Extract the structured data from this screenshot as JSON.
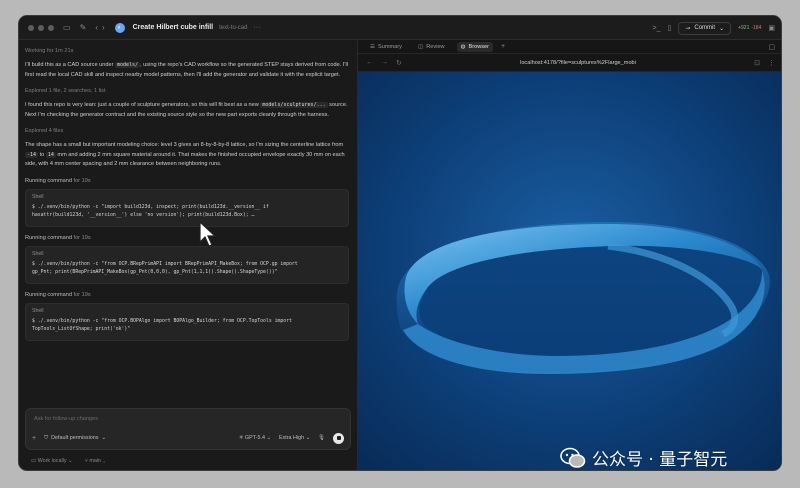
{
  "titlebar": {
    "title": "Create Hilbert cube infill",
    "subtitle": "text-to-cad",
    "more": "···",
    "commit_label": "Commit",
    "additions": "+921",
    "deletions": "-184",
    "colors": {
      "background": "#1c1c1c",
      "title": "#e8e8e8"
    },
    "icons": [
      "sidebar-icon",
      "new-chat-icon",
      "back-icon",
      "forward-icon",
      "terminal-icon",
      "split-icon",
      "git-commit-icon",
      "layout-icon"
    ]
  },
  "chat": {
    "working_for": "Working for 1m 21s",
    "para1_a": "I'll build this as a CAD source under",
    "para1_code": "models/",
    "para1_b": ", using the repo's CAD workflow so the generated STEP stays derived from code. I'll first read the local CAD skill and inspect nearby model patterns, then I'll add the generator and validate it with the explicit target.",
    "explored1": "Explored 1 file, 2 searches, 1 list",
    "para2_a": "I found this repo is very lean: just a couple of sculpture generators, so this will fit best as a new",
    "para2_code": "models/sculptures/...",
    "para2_b": "source. Next I'm checking the generator contract and the existing source style so the new part exports cleanly through the harness.",
    "explored2": "Explored 4 files",
    "para3_a": "The shape has a small but important modeling choice: level 3 gives an 8-by-8-by-8 lattice, so I'm sizing the centerline lattice from",
    "para3_code1": "-14",
    "para3_to": "to",
    "para3_code2": "14",
    "para3_b": "mm and adding 2 mm square material around it. That makes the finished occupied envelope exactly 30 mm on each side, with 4 mm center spacing and 2 mm clearance between neighboring runs.",
    "runs": [
      {
        "running": "Running command",
        "duration": "for 19s",
        "label": "Shell",
        "line1": "$ ./.venv/bin/python -c \"import build123d, inspect; print(build123d.__version__ if",
        "line2": "hasattr(build123d, '__version__') else 'no version'); print(build123d.Box); …"
      },
      {
        "running": "Running command",
        "duration": "for 19s",
        "label": "Shell",
        "line1": "$ ./.venv/bin/python -c \"from OCP.BRepPrimAPI import BRepPrimAPI_MakeBox; from OCP.gp import",
        "line2": "gp_Pnt; print(BRepPrimAPI_MakeBox(gp_Pnt(0,0,0), gp_Pnt(1,1,1)).Shape().ShapeType())\""
      },
      {
        "running": "Running command",
        "duration": "for 19s",
        "label": "Shell",
        "line1": "$ ./.venv/bin/python -c \"from OCP.BOPAlgo import BOPAlgo_Builder; from OCP.TopTools import",
        "line2": "TopTools_ListOfShape; print('ok')\""
      }
    ],
    "composer_placeholder": "Ask for follow-up changes",
    "permissions": "Default permissions",
    "model": "GPT-5.4",
    "effort": "Extra High",
    "footer_local": "Work locally",
    "footer_branch": "main"
  },
  "browser": {
    "tabs": [
      "Summary",
      "Review",
      "Browser"
    ],
    "active_tab": 2,
    "url": "localhost:4178/?file=sculptures%2Flarge_mobi",
    "viewport_bg": "#0a3a6e",
    "model_color": "#1f78c0"
  },
  "watermark": {
    "text": "公众号 · 量子智元",
    "icon": "wechat-icon"
  }
}
